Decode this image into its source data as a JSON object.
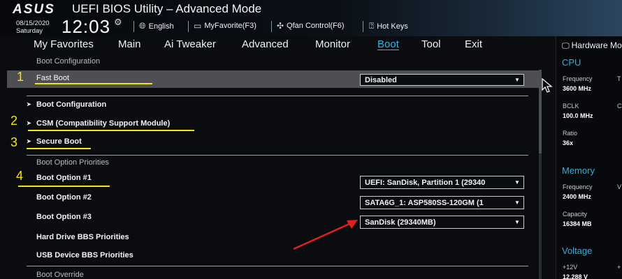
{
  "header": {
    "brand": "ASUS",
    "title": "UEFI BIOS Utility – Advanced Mode",
    "date": "08/15/2020",
    "day": "Saturday",
    "time": "12:03",
    "items": [
      {
        "icon": "globe-icon",
        "label": "English"
      },
      {
        "icon": "myfavorite-icon",
        "label": "MyFavorite(F3)"
      },
      {
        "icon": "fan-icon",
        "label": "Qfan Control(F6)"
      },
      {
        "icon": "help-icon",
        "label": "Hot Keys"
      }
    ]
  },
  "tabs": [
    "My Favorites",
    "Main",
    "Ai Tweaker",
    "Advanced",
    "Monitor",
    "Boot",
    "Tool",
    "Exit"
  ],
  "active_tab": "Boot",
  "main": {
    "boot_configuration_header": "Boot Configuration",
    "fast_boot": {
      "label": "Fast Boot",
      "value": "Disabled"
    },
    "submenus": [
      "Boot Configuration",
      "CSM (Compatibility Support Module)",
      "Secure Boot"
    ],
    "boot_option_priorities_header": "Boot Option Priorities",
    "boot_options": [
      {
        "label": "Boot Option #1",
        "value": "UEFI: SanDisk, Partition 1 (29340"
      },
      {
        "label": "Boot Option #2",
        "value": "SATA6G_1: ASP580SS-120GM (1"
      },
      {
        "label": "Boot Option #3",
        "value": "SanDisk (29340MB)"
      }
    ],
    "links": [
      "Hard Drive BBS Priorities",
      "USB Device BBS Priorities"
    ],
    "partial_header": "Boot Override"
  },
  "hardware_monitor": {
    "title": "Hardware Monitor",
    "cpu": {
      "section": "CPU",
      "frequency_label": "Frequency",
      "frequency_value": "3600 MHz",
      "bclk_label": "BCLK",
      "bclk_value": "100.0 MHz",
      "ratio_label": "Ratio",
      "ratio_value": "36x",
      "cut_labels": [
        "T",
        "C"
      ]
    },
    "memory": {
      "section": "Memory",
      "frequency_label": "Frequency",
      "frequency_value": "2400 MHz",
      "capacity_label": "Capacity",
      "capacity_value": "16384 MB",
      "cut_label": "V"
    },
    "voltage": {
      "section": "Voltage",
      "v12_label": "+12V",
      "v12_value": "12.288 V",
      "cut_label": "+"
    }
  },
  "annotations": [
    "1",
    "2",
    "3",
    "4"
  ],
  "colors": {
    "accent": "#33b6e8",
    "annotation": "#f5e50c",
    "arrow": "#e02020"
  }
}
